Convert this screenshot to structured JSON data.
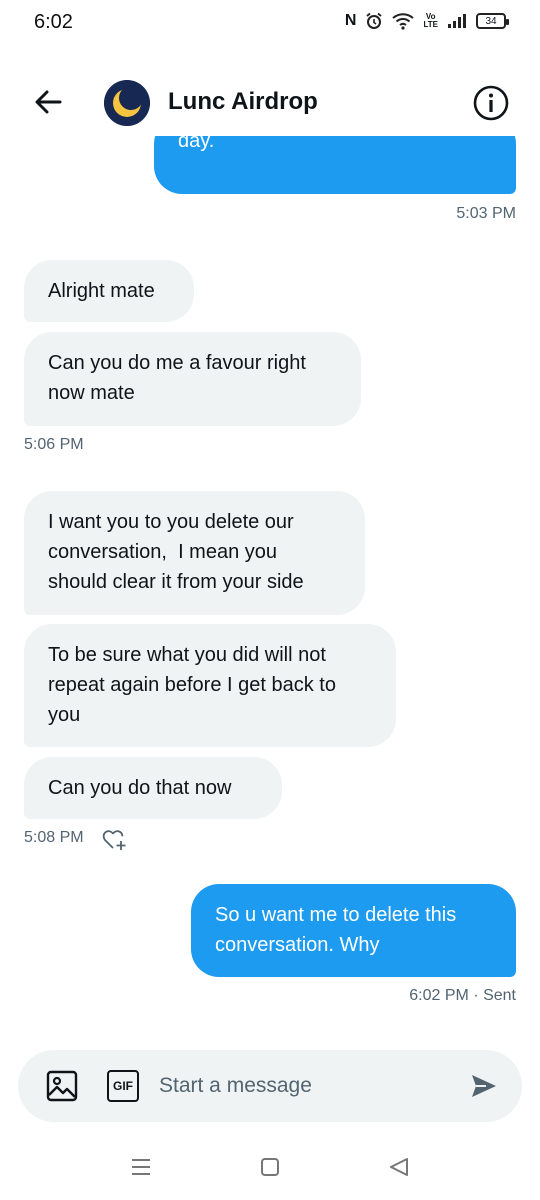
{
  "status_bar": {
    "time": "6:02",
    "nfc": "N",
    "volte_line1": "Vo",
    "volte_line2": "LTE",
    "battery": "34",
    "icons": [
      "nfc-icon",
      "alarm-icon",
      "wifi-icon",
      "volte-icon",
      "signal-icon",
      "battery-icon"
    ]
  },
  "header": {
    "title": "Lunc Airdrop",
    "back_icon": "arrow-left-icon",
    "info_icon": "info-icon",
    "avatar_icon": "terra-luna-logo"
  },
  "messages": [
    {
      "kind": "sent",
      "text": "day."
    },
    {
      "kind": "timestamp",
      "text": "5:03 PM"
    },
    {
      "kind": "received",
      "text": "Alright mate"
    },
    {
      "kind": "received",
      "line1": "Can you do me a favour right",
      "line2": "now mate"
    },
    {
      "kind": "timestamp",
      "text": "5:06 PM"
    },
    {
      "kind": "received",
      "line1": "I want you to you delete our",
      "line2": "conversation,  I mean you",
      "line3": "should clear it from your side"
    },
    {
      "kind": "received",
      "line1": "To be sure what you did will not",
      "line2": "repeat again before I get back to",
      "line3": "you"
    },
    {
      "kind": "received",
      "text": "Can you do that now"
    },
    {
      "kind": "timestamp",
      "text": "5:08 PM",
      "icon": "heart-add-icon"
    },
    {
      "kind": "sent",
      "line1": "So u want me to delete this",
      "line2": "conversation. Why"
    },
    {
      "kind": "timestamp",
      "text": "6:02 PM · Sent"
    }
  ],
  "composer": {
    "placeholder": "Start a message",
    "image_icon": "image-icon",
    "gif_label": "GIF",
    "send_icon": "send-icon"
  },
  "colors": {
    "accent": "#1d9bf0",
    "received_bubble": "#eff3f4",
    "secondary_text": "#536471",
    "avatar_bg": "#172852",
    "avatar_moon": "#f5c542"
  },
  "nav_bar": {
    "icons": [
      "menu-icon",
      "home-square-icon",
      "back-triangle-icon"
    ]
  }
}
